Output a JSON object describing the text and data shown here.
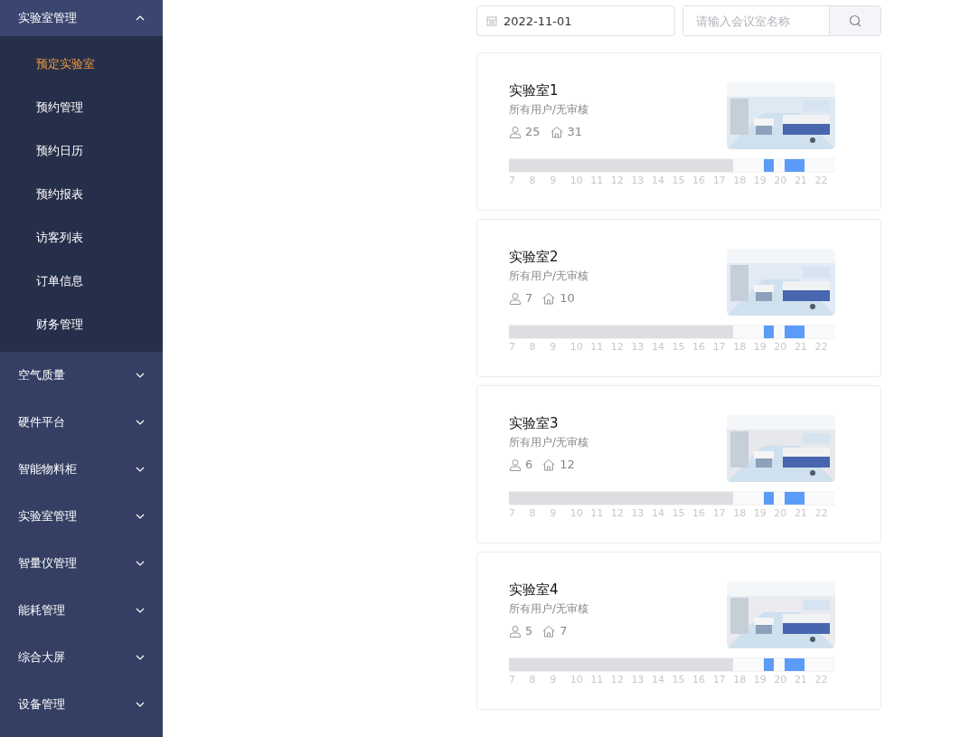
{
  "sidebar": {
    "items": [
      {
        "label": "实验室管理",
        "expanded": true,
        "children": [
          {
            "label": "预定实验室",
            "selected": true
          },
          {
            "label": "预约管理",
            "selected": false
          },
          {
            "label": "预约日历",
            "selected": false
          },
          {
            "label": "预约报表",
            "selected": false
          },
          {
            "label": "访客列表",
            "selected": false
          },
          {
            "label": "订单信息",
            "selected": false
          },
          {
            "label": "财务管理",
            "selected": false
          }
        ]
      },
      {
        "label": "空气质量",
        "expanded": false
      },
      {
        "label": "硬件平台",
        "expanded": false
      },
      {
        "label": "智能物料柜",
        "expanded": false
      },
      {
        "label": "实验室管理",
        "expanded": false
      },
      {
        "label": "智量仪管理",
        "expanded": false
      },
      {
        "label": "能耗管理",
        "expanded": false
      },
      {
        "label": "综合大屏",
        "expanded": false
      },
      {
        "label": "设备管理",
        "expanded": false
      }
    ]
  },
  "filters": {
    "date": "2022-11-01",
    "search": {
      "placeholder": "请输入会议室名称"
    }
  },
  "rooms": [
    {
      "name": "实验室1",
      "access": "所有用户/无审核",
      "capacity": "25",
      "area": "31",
      "hours": [
        "7",
        "8",
        "9",
        "10",
        "11",
        "12",
        "13",
        "14",
        "15",
        "16",
        "17",
        "18",
        "19",
        "20",
        "21",
        "22"
      ],
      "slots": [
        {
          "past": true,
          "booked": false
        },
        {
          "past": true,
          "booked": false
        },
        {
          "past": true,
          "booked": false
        },
        {
          "past": true,
          "booked": false
        },
        {
          "past": true,
          "booked": false
        },
        {
          "past": true,
          "booked": false
        },
        {
          "past": true,
          "booked": false
        },
        {
          "past": true,
          "booked": false
        },
        {
          "past": true,
          "booked": false
        },
        {
          "past": true,
          "booked": false
        },
        {
          "past": true,
          "booked": false
        },
        {
          "past": true,
          "booked": false
        },
        {
          "past": true,
          "booked": false
        },
        {
          "past": true,
          "booked": false
        },
        {
          "past": true,
          "booked": false
        },
        {
          "past": true,
          "booked": false
        },
        {
          "past": true,
          "booked": false
        },
        {
          "past": true,
          "booked": false
        },
        {
          "past": true,
          "booked": false
        },
        {
          "past": true,
          "booked": false
        },
        {
          "past": true,
          "booked": false
        },
        {
          "past": true,
          "booked": false
        },
        {
          "past": false,
          "booked": false
        },
        {
          "past": false,
          "booked": false
        },
        {
          "past": false,
          "booked": false
        },
        {
          "past": false,
          "booked": true
        },
        {
          "past": false,
          "booked": false
        },
        {
          "past": false,
          "booked": true
        },
        {
          "past": false,
          "booked": true
        },
        {
          "past": false,
          "booked": false
        },
        {
          "past": false,
          "booked": false
        },
        {
          "past": false,
          "booked": false
        }
      ]
    },
    {
      "name": "实验室2",
      "access": "所有用户/无审核",
      "capacity": "7",
      "area": "10",
      "hours": [
        "7",
        "8",
        "9",
        "10",
        "11",
        "12",
        "13",
        "14",
        "15",
        "16",
        "17",
        "18",
        "19",
        "20",
        "21",
        "22"
      ],
      "slots": [
        {
          "past": true,
          "booked": false
        },
        {
          "past": true,
          "booked": false
        },
        {
          "past": true,
          "booked": false
        },
        {
          "past": true,
          "booked": false
        },
        {
          "past": true,
          "booked": false
        },
        {
          "past": true,
          "booked": false
        },
        {
          "past": true,
          "booked": false
        },
        {
          "past": true,
          "booked": false
        },
        {
          "past": true,
          "booked": false
        },
        {
          "past": true,
          "booked": false
        },
        {
          "past": true,
          "booked": false
        },
        {
          "past": true,
          "booked": false
        },
        {
          "past": true,
          "booked": false
        },
        {
          "past": true,
          "booked": false
        },
        {
          "past": true,
          "booked": false
        },
        {
          "past": true,
          "booked": false
        },
        {
          "past": true,
          "booked": false
        },
        {
          "past": true,
          "booked": false
        },
        {
          "past": true,
          "booked": false
        },
        {
          "past": true,
          "booked": false
        },
        {
          "past": true,
          "booked": false
        },
        {
          "past": true,
          "booked": false
        },
        {
          "past": false,
          "booked": false
        },
        {
          "past": false,
          "booked": false
        },
        {
          "past": false,
          "booked": false
        },
        {
          "past": false,
          "booked": true
        },
        {
          "past": false,
          "booked": false
        },
        {
          "past": false,
          "booked": true
        },
        {
          "past": false,
          "booked": true
        },
        {
          "past": false,
          "booked": false
        },
        {
          "past": false,
          "booked": false
        },
        {
          "past": false,
          "booked": false
        }
      ]
    },
    {
      "name": "实验室3",
      "access": "所有用户/无审核",
      "capacity": "6",
      "area": "12",
      "hours": [
        "7",
        "8",
        "9",
        "10",
        "11",
        "12",
        "13",
        "14",
        "15",
        "16",
        "17",
        "18",
        "19",
        "20",
        "21",
        "22"
      ],
      "slots": [
        {
          "past": true,
          "booked": false
        },
        {
          "past": true,
          "booked": false
        },
        {
          "past": true,
          "booked": false
        },
        {
          "past": true,
          "booked": false
        },
        {
          "past": true,
          "booked": false
        },
        {
          "past": true,
          "booked": false
        },
        {
          "past": true,
          "booked": false
        },
        {
          "past": true,
          "booked": false
        },
        {
          "past": true,
          "booked": false
        },
        {
          "past": true,
          "booked": false
        },
        {
          "past": true,
          "booked": false
        },
        {
          "past": true,
          "booked": false
        },
        {
          "past": true,
          "booked": false
        },
        {
          "past": true,
          "booked": false
        },
        {
          "past": true,
          "booked": false
        },
        {
          "past": true,
          "booked": false
        },
        {
          "past": true,
          "booked": false
        },
        {
          "past": true,
          "booked": false
        },
        {
          "past": true,
          "booked": false
        },
        {
          "past": true,
          "booked": false
        },
        {
          "past": true,
          "booked": false
        },
        {
          "past": true,
          "booked": false
        },
        {
          "past": false,
          "booked": false
        },
        {
          "past": false,
          "booked": false
        },
        {
          "past": false,
          "booked": false
        },
        {
          "past": false,
          "booked": true
        },
        {
          "past": false,
          "booked": false
        },
        {
          "past": false,
          "booked": true
        },
        {
          "past": false,
          "booked": true
        },
        {
          "past": false,
          "booked": false
        },
        {
          "past": false,
          "booked": false
        },
        {
          "past": false,
          "booked": false
        }
      ]
    },
    {
      "name": "实验室4",
      "access": "所有用户/无审核",
      "capacity": "5",
      "area": "7",
      "hours": [
        "7",
        "8",
        "9",
        "10",
        "11",
        "12",
        "13",
        "14",
        "15",
        "16",
        "17",
        "18",
        "19",
        "20",
        "21",
        "22"
      ],
      "slots": [
        {
          "past": true,
          "booked": false
        },
        {
          "past": true,
          "booked": false
        },
        {
          "past": true,
          "booked": false
        },
        {
          "past": true,
          "booked": false
        },
        {
          "past": true,
          "booked": false
        },
        {
          "past": true,
          "booked": false
        },
        {
          "past": true,
          "booked": false
        },
        {
          "past": true,
          "booked": false
        },
        {
          "past": true,
          "booked": false
        },
        {
          "past": true,
          "booked": false
        },
        {
          "past": true,
          "booked": false
        },
        {
          "past": true,
          "booked": false
        },
        {
          "past": true,
          "booked": false
        },
        {
          "past": true,
          "booked": false
        },
        {
          "past": true,
          "booked": false
        },
        {
          "past": true,
          "booked": false
        },
        {
          "past": true,
          "booked": false
        },
        {
          "past": true,
          "booked": false
        },
        {
          "past": true,
          "booked": false
        },
        {
          "past": true,
          "booked": false
        },
        {
          "past": true,
          "booked": false
        },
        {
          "past": true,
          "booked": false
        },
        {
          "past": false,
          "booked": false
        },
        {
          "past": false,
          "booked": false
        },
        {
          "past": false,
          "booked": false
        },
        {
          "past": false,
          "booked": true
        },
        {
          "past": false,
          "booked": false
        },
        {
          "past": false,
          "booked": true
        },
        {
          "past": false,
          "booked": true
        },
        {
          "past": false,
          "booked": false
        },
        {
          "past": false,
          "booked": false
        },
        {
          "past": false,
          "booked": false
        }
      ]
    }
  ]
}
